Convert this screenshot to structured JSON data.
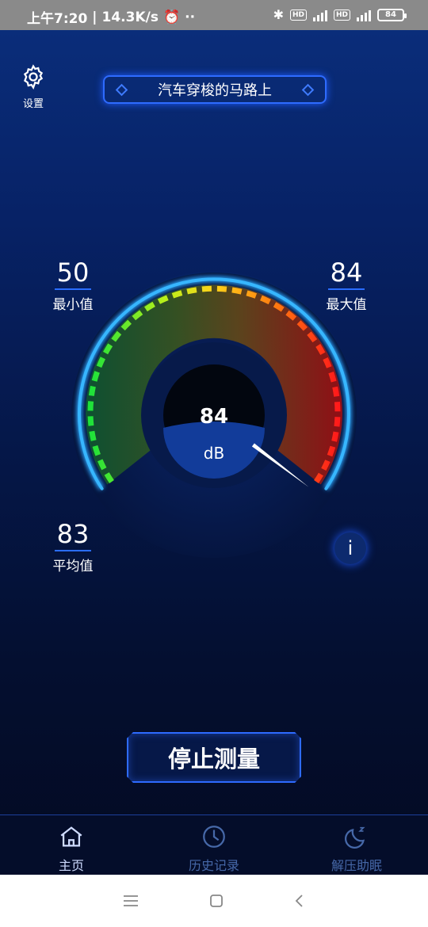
{
  "status_bar": {
    "time": "上午7:20",
    "net_speed": "14.3K/s",
    "hd1": "HD",
    "hd2": "HD",
    "battery": "84"
  },
  "header": {
    "settings_label": "设置",
    "scene_text": "汽车穿梭的马路上"
  },
  "stats": {
    "min_value": "50",
    "min_label": "最小值",
    "max_value": "84",
    "max_label": "最大值",
    "avg_value": "83",
    "avg_label": "平均值"
  },
  "gauge": {
    "current_value": "84",
    "unit": "dB",
    "range": [
      0,
      120
    ],
    "current_db": 84
  },
  "info_label": "i",
  "stop_button_label": "停止测量",
  "bottom_nav": {
    "home": "主页",
    "history": "历史记录",
    "relax": "解压助眠"
  },
  "colors": {
    "accent": "#2e6bff",
    "background_top": "#0a2d7a",
    "background_bottom": "#030a22"
  }
}
